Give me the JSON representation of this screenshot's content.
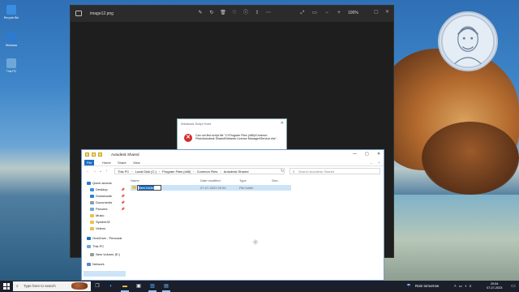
{
  "desktop": {
    "icons": [
      {
        "label": "Recycle Bin",
        "color": "#3a8ee0"
      },
      {
        "label": "Windows",
        "color": "#2f7ad0"
      },
      {
        "label": "This PC",
        "color": "#6fa7d8"
      }
    ]
  },
  "viewer": {
    "title": "image12.png",
    "zoom": "100%"
  },
  "script_host": {
    "title": "Windows Script Host",
    "message": "Can not find script file \"C:\\Program Files (x86)\\Common Files\\Autodesk Shared\\Network License Manager\\Service.vbs\"."
  },
  "explorer": {
    "title": "Autodesk Shared",
    "tabs": [
      "File",
      "Home",
      "Share",
      "View"
    ],
    "breadcrumb": [
      "This PC",
      "Local Disk (C:)",
      "Program Files (x86)",
      "Common Files",
      "Autodesk Shared"
    ],
    "search_placeholder": "Search Autodesk Shared",
    "nav": [
      {
        "label": "Quick access",
        "color": "#2a7ad0",
        "pinned": false
      },
      {
        "label": "Desktop",
        "color": "#3a8ee0",
        "pinned": true
      },
      {
        "label": "Downloads",
        "color": "#2d7dd2",
        "pinned": true
      },
      {
        "label": "Documents",
        "color": "#8a9bb0",
        "pinned": true
      },
      {
        "label": "Pictures",
        "color": "#6fa7d8",
        "pinned": true
      },
      {
        "label": "Music",
        "color": "#e9c050",
        "pinned": false
      },
      {
        "label": "System32",
        "color": "#e9c050",
        "pinned": false
      },
      {
        "label": "Videos",
        "color": "#e9c050",
        "pinned": false
      },
      {
        "label": "OneDrive - Personal",
        "color": "#1c6fc7",
        "pinned": false
      },
      {
        "label": "This PC",
        "color": "#6fa7d8",
        "pinned": false
      },
      {
        "label": "New Volume (E:)",
        "color": "#999999",
        "pinned": false
      },
      {
        "label": "Network",
        "color": "#5b87c2",
        "pinned": false
      }
    ],
    "columns": [
      "Name",
      "Date modified",
      "Type",
      "Size"
    ],
    "rows": [
      {
        "name": "New folder",
        "date": "07-07-2023 20:54",
        "type": "File folder",
        "size": ""
      }
    ]
  },
  "taskbar": {
    "search_placeholder": "Type here to search",
    "weather": "Rain tomorrow",
    "time": "20:54",
    "date": "07-07-2023"
  }
}
